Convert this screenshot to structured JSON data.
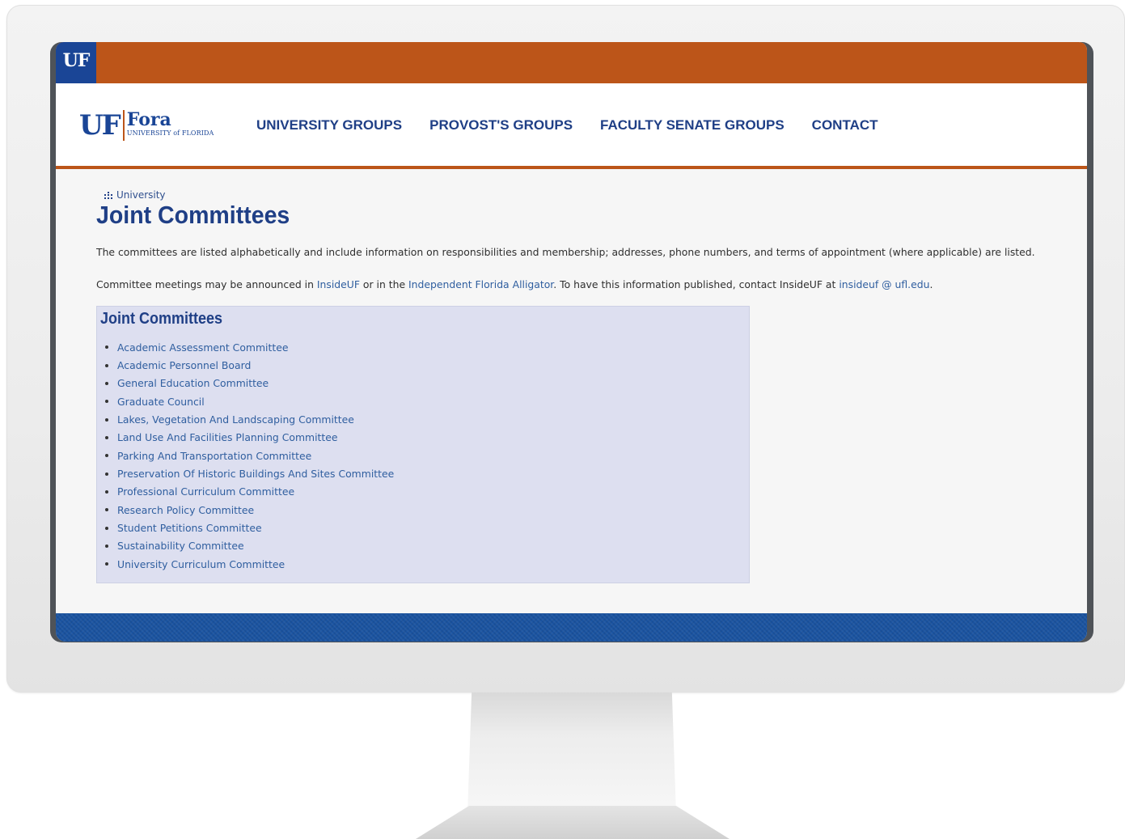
{
  "top_bar": {
    "badge": "UF"
  },
  "header": {
    "logo": {
      "mark": "UF",
      "name": "Fora",
      "subtitle": "UNIVERSITY of FLORIDA"
    },
    "nav": [
      {
        "label": "UNIVERSITY GROUPS"
      },
      {
        "label": "PROVOST'S GROUPS"
      },
      {
        "label": "FACULTY SENATE GROUPS"
      },
      {
        "label": "CONTACT"
      }
    ]
  },
  "breadcrumb": {
    "icon": "sitemap-icon",
    "label": "University"
  },
  "page": {
    "title": "Joint Committees",
    "intro": "The committees are listed alphabetically and include information on responsibilities and membership; addresses, phone numbers, and terms of appointment (where applicable) are listed.",
    "meetings": {
      "prefix": "Committee meetings may be announced in ",
      "link1": "InsideUF",
      "middle": " or in the ",
      "link2": "Independent Florida Alligator",
      "after": ". To have this information published, contact InsideUF at ",
      "email": "insideuf @ ufl.edu",
      "end": "."
    }
  },
  "committees_box": {
    "title": "Joint Committees",
    "items": [
      {
        "label": "Academic Assessment Committee"
      },
      {
        "label": "Academic Personnel Board"
      },
      {
        "label": "General Education Committee"
      },
      {
        "label": "Graduate Council"
      },
      {
        "label": "Lakes, Vegetation And Landscaping Committee"
      },
      {
        "label": "Land Use And Facilities Planning Committee"
      },
      {
        "label": "Parking And Transportation Committee"
      },
      {
        "label": "Preservation Of Historic Buildings And Sites Committee"
      },
      {
        "label": "Professional Curriculum Committee"
      },
      {
        "label": "Research Policy Committee"
      },
      {
        "label": "Student Petitions Committee"
      },
      {
        "label": "Sustainability Committee"
      },
      {
        "label": "University Curriculum Committee"
      }
    ]
  },
  "colors": {
    "uf_orange": "#bc5519",
    "uf_blue": "#1a4596",
    "link_blue": "#2f5e9f",
    "box_bg": "#dddff0"
  }
}
